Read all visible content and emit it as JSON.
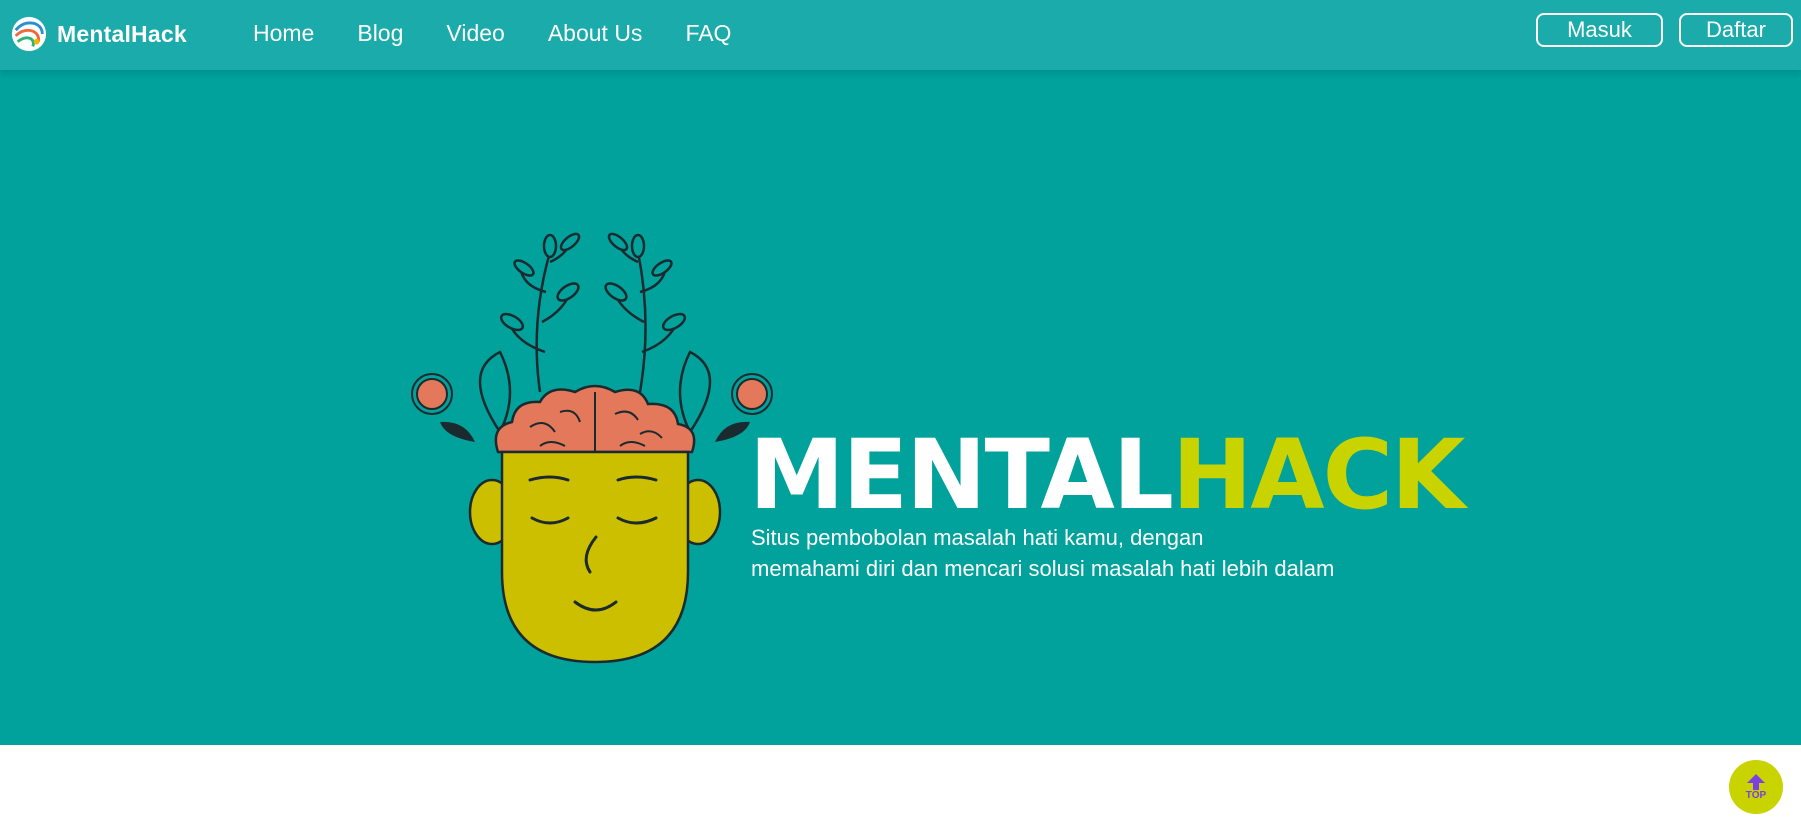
{
  "brand": {
    "name": "MentalHack",
    "logo_icon": "mentalhack-logo-icon"
  },
  "nav": {
    "links": [
      {
        "label": "Home"
      },
      {
        "label": "Blog"
      },
      {
        "label": "Video"
      },
      {
        "label": "About Us"
      },
      {
        "label": "FAQ"
      }
    ],
    "login_label": "Masuk",
    "register_label": "Daftar"
  },
  "hero": {
    "title_part1": "MENTAL",
    "title_part2": "HACK",
    "subtitle_line1": "Situs pembobolan masalah hati kamu, dengan",
    "subtitle_line2": "memahami diri dan mencari solusi masalah hati lebih dalam",
    "illustration_icon": "head-with-brain-and-flowers-illustration"
  },
  "scroll_top": {
    "label": "TOP",
    "icon": "arrow-up-icon"
  },
  "colors": {
    "navbar": "#1aabaa",
    "hero_bg": "#01a19c",
    "accent": "#c8d300",
    "top_label": "#7b3fe4"
  }
}
